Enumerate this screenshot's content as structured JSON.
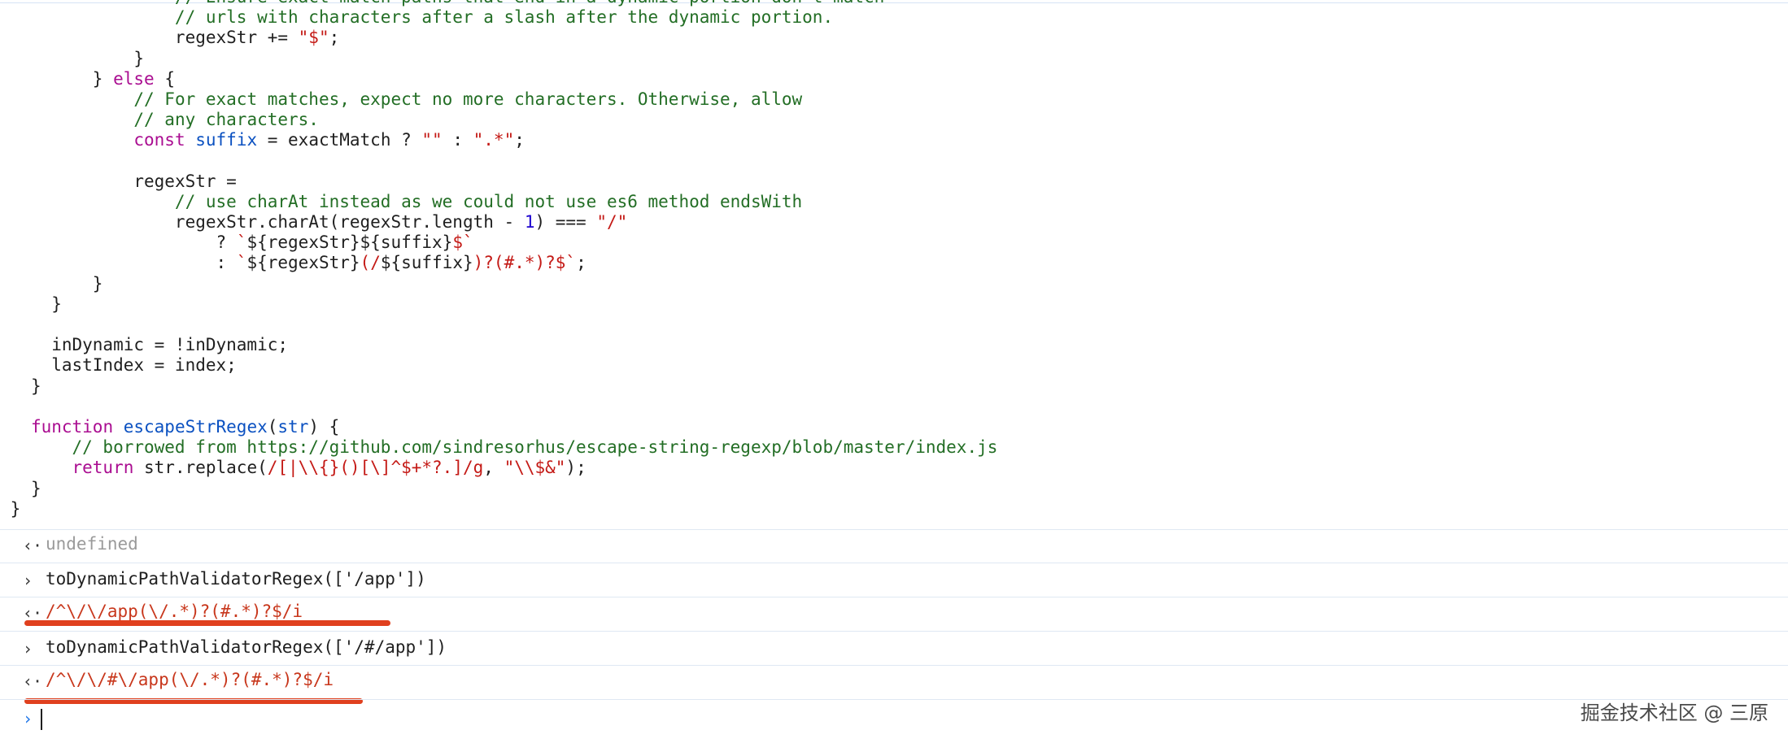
{
  "code_lines": [
    {
      "indent": "",
      "tokens": [
        {
          "t": "c",
          "v": "      // Ensure exact match paths that end in a dynamic portion don't match"
        }
      ]
    },
    {
      "indent": "",
      "tokens": [
        {
          "t": "c",
          "v": "      // urls with characters after a slash after the dynamic portion."
        }
      ]
    },
    {
      "indent": "",
      "tokens": [
        {
          "t": "p",
          "v": "      regexStr += "
        },
        {
          "t": "s",
          "v": "\"$\""
        },
        {
          "t": "p",
          "v": ";"
        }
      ]
    },
    {
      "indent": "",
      "tokens": [
        {
          "t": "p",
          "v": "    }"
        }
      ]
    },
    {
      "indent": "",
      "tokens": [
        {
          "t": "p",
          "v": "  } "
        },
        {
          "t": "k",
          "v": "else"
        },
        {
          "t": "p",
          "v": " {"
        }
      ]
    },
    {
      "indent": "",
      "tokens": [
        {
          "t": "c",
          "v": "    // For exact matches, expect no more characters. Otherwise, allow"
        }
      ]
    },
    {
      "indent": "",
      "tokens": [
        {
          "t": "c",
          "v": "    // any characters."
        }
      ]
    },
    {
      "indent": "",
      "tokens": [
        {
          "t": "k",
          "v": "    const"
        },
        {
          "t": "f",
          "v": " suffix"
        },
        {
          "t": "p",
          "v": " = exactMatch ? "
        },
        {
          "t": "s",
          "v": "\"\""
        },
        {
          "t": "p",
          "v": " : "
        },
        {
          "t": "s",
          "v": "\".*\""
        },
        {
          "t": "p",
          "v": ";"
        }
      ]
    },
    {
      "indent": "",
      "tokens": [
        {
          "t": "p",
          "v": ""
        }
      ]
    },
    {
      "indent": "",
      "tokens": [
        {
          "t": "p",
          "v": "    regexStr ="
        }
      ]
    },
    {
      "indent": "",
      "tokens": [
        {
          "t": "c",
          "v": "      // use charAt instead as we could not use es6 method endsWith"
        }
      ]
    },
    {
      "indent": "",
      "tokens": [
        {
          "t": "p",
          "v": "      regexStr.charAt(regexStr.length - "
        },
        {
          "t": "n",
          "v": "1"
        },
        {
          "t": "p",
          "v": ") === "
        },
        {
          "t": "s",
          "v": "\"/\""
        }
      ]
    },
    {
      "indent": "",
      "tokens": [
        {
          "t": "p",
          "v": "        ? "
        },
        {
          "t": "s",
          "v": "`"
        },
        {
          "t": "p",
          "v": "${regexStr}${suffix}"
        },
        {
          "t": "s",
          "v": "$`"
        }
      ]
    },
    {
      "indent": "",
      "tokens": [
        {
          "t": "p",
          "v": "        : "
        },
        {
          "t": "s",
          "v": "`"
        },
        {
          "t": "p",
          "v": "${regexStr}"
        },
        {
          "t": "s",
          "v": "(/"
        },
        {
          "t": "p",
          "v": "${suffix}"
        },
        {
          "t": "s",
          "v": ")?(#.*)?$`"
        },
        {
          "t": "p",
          "v": ";"
        }
      ]
    },
    {
      "indent": "",
      "tokens": [
        {
          "t": "p",
          "v": "  }"
        }
      ]
    },
    {
      "indent": "",
      "tokens": [
        {
          "t": "p",
          "v": "}"
        }
      ]
    },
    {
      "indent": "",
      "tokens": [
        {
          "t": "p",
          "v": ""
        }
      ]
    },
    {
      "indent": "",
      "tokens": [
        {
          "t": "p",
          "v": "inDynamic = !inDynamic;"
        }
      ]
    },
    {
      "indent": "",
      "tokens": [
        {
          "t": "p",
          "v": "lastIndex = index;"
        }
      ]
    },
    {
      "indent": "",
      "tokens": [
        {
          "t": "p",
          "v": "}"
        }
      ]
    },
    {
      "indent": "",
      "tokens": [
        {
          "t": "p",
          "v": ""
        }
      ]
    },
    {
      "indent": "",
      "tokens": [
        {
          "t": "k",
          "v": "function"
        },
        {
          "t": "f",
          "v": " escapeStrRegex"
        },
        {
          "t": "p",
          "v": "("
        },
        {
          "t": "f",
          "v": "str"
        },
        {
          "t": "p",
          "v": ") {"
        }
      ]
    },
    {
      "indent": "",
      "tokens": [
        {
          "t": "c",
          "v": "  // borrowed from https://github.com/sindresorhus/escape-string-regexp/blob/master/index.js"
        }
      ]
    },
    {
      "indent": "",
      "tokens": [
        {
          "t": "k",
          "v": "  return"
        },
        {
          "t": "p",
          "v": " str.replace("
        },
        {
          "t": "s",
          "v": "/[|\\\\{}()[\\]^$+*?.]/g"
        },
        {
          "t": "p",
          "v": ", "
        },
        {
          "t": "s",
          "v": "\"\\\\$&\""
        },
        {
          "t": "p",
          "v": ");"
        }
      ]
    },
    {
      "indent": "",
      "tokens": [
        {
          "t": "p",
          "v": "}"
        }
      ]
    },
    {
      "indent": "",
      "tokens": [
        {
          "t": "p",
          "v": "}"
        }
      ]
    }
  ],
  "console": {
    "result_undefined": "undefined",
    "input_1": "toDynamicPathValidatorRegex(['/app'])",
    "output_1": "/^\\/\\/app(\\/.*)?(#.*)?$/i",
    "input_2": "toDynamicPathValidatorRegex(['/#/app'])",
    "output_2": "/^\\/\\/#\\/app(\\/.*)?(#.*)?$/i",
    "prompt_glyph": "›",
    "result_glyph": "‹·"
  },
  "watermark": "掘金技术社区 @ 三原",
  "colors": {
    "keyword": "#aa0d91",
    "comment": "#236e25",
    "string": "#c41a16",
    "number": "#1c00cf",
    "identifier": "#0b51c1",
    "underline": "#e0401e"
  }
}
